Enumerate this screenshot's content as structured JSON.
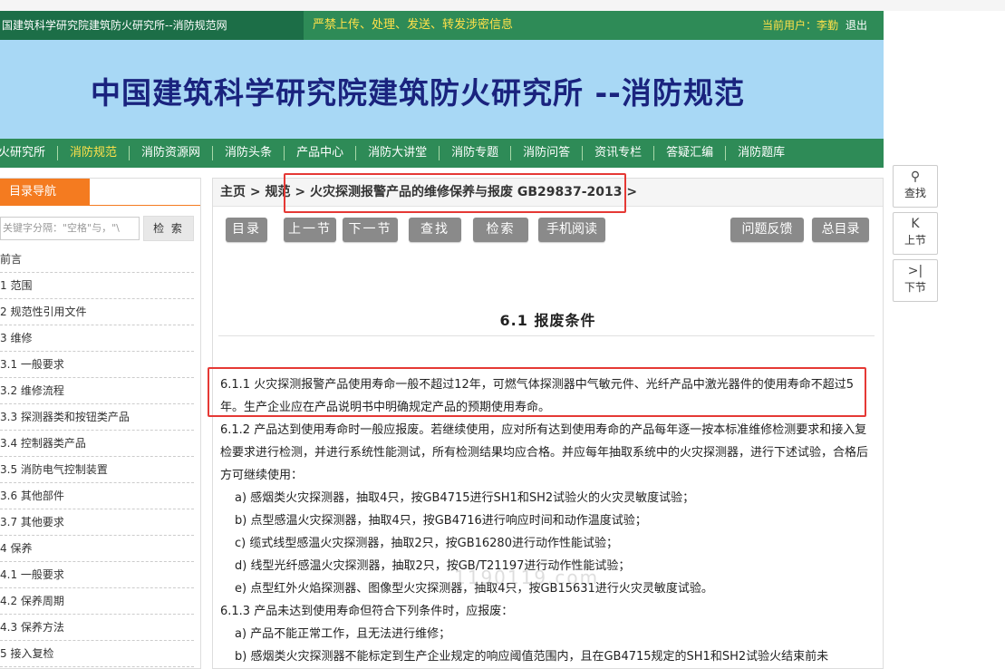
{
  "topbar": {
    "site_title": "国建筑科学研究院建筑防火研究所--消防规范网",
    "warning": "严禁上传、处理、发送、转发涉密信息",
    "user_label": "当前用户：李勤",
    "logout": "退出"
  },
  "banner": {
    "title": "中国建筑科学研究院建筑防火研究所 --消防规范"
  },
  "nav": [
    "火研究所",
    "消防规范",
    "消防资源网",
    "消防头条",
    "产品中心",
    "消防大讲堂",
    "消防专题",
    "消防问答",
    "资讯专栏",
    "答疑汇编",
    "消防题库"
  ],
  "sidebar": {
    "title": "目录导航",
    "search_placeholder": "关键字分隔：\"空格\"与，\"\\",
    "search_button": "检 索",
    "items": [
      "前言",
      "1 范围",
      "2 规范性引用文件",
      "3 维修",
      "3.1 一般要求",
      "3.2 维修流程",
      "3.3 探测器类和按钮类产品",
      "3.4 控制器类产品",
      "3.5 消防电气控制装置",
      "3.6 其他部件",
      "3.7 其他要求",
      "4 保养",
      "4.1 一般要求",
      "4.2 保养周期",
      "4.3 保养方法",
      "5 接入复检"
    ]
  },
  "breadcrumb": {
    "home": "主页",
    "sep1": " > ",
    "level1": "规范",
    "sep2": " > ",
    "current": "火灾探测报警产品的维修保养与报废 GB29837-2013",
    "sep3": " >"
  },
  "toolbar": {
    "toc": "目录",
    "prev": "上一节",
    "next": "下一节",
    "find": "查找",
    "search": "检索",
    "mobile": "手机阅读",
    "feedback": "问题反馈",
    "main_toc": "总目录"
  },
  "section": {
    "title": "6.1 报废条件"
  },
  "content": {
    "p1": "6.1.1 火灾探测报警产品使用寿命一般不超过12年，可燃气体探测器中气敏元件、光纤产品中激光器件的使用寿命不超过5年。生产企业应在产品说明书中明确规定产品的预期使用寿命。",
    "p2": "6.1.2 产品达到使用寿命时一般应报废。若继续使用，应对所有达到使用寿命的产品每年逐一按本标准维修检测要求和接入复检要求进行检测，并进行系统性能测试，所有检测结果均应合格。并应每年抽取系统中的火灾探测器，进行下述试验，合格后方可继续使用：",
    "a": "a) 感烟类火灾探测器，抽取4只，按GB4715进行SH1和SH2试验火的火灾灵敏度试验；",
    "b": "b) 点型感温火灾探测器，抽取4只，按GB4716进行响应时间和动作温度试验；",
    "c": "c) 缆式线型感温火灾探测器，抽取2只，按GB16280进行动作性能试验；",
    "d": "d) 线型光纤感温火灾探测器，抽取2只，按GB/T21197进行动作性能试验；",
    "e": "e) 点型红外火焰探测器、图像型火灾探测器，抽取4只，按GB15631进行火灾灵敏度试验。",
    "p3": "6.1.3 产品未达到使用寿命但符合下列条件时，应报废：",
    "p3a": "a) 产品不能正常工作，且无法进行维修；",
    "p3b": "b) 感烟类火灾探测器不能标定到生产企业规定的响应阈值范围内，且在GB4715规定的SH1和SH2试验火结束前未"
  },
  "watermark": "1190119.com",
  "float": {
    "find": "查找",
    "up": "上节",
    "down": "下节"
  },
  "colors": {
    "green": "#2e8b57",
    "banner": "#a8d8f5",
    "orange": "#f47b20",
    "highlight": "#e53935",
    "yellow": "#ffe14a"
  }
}
